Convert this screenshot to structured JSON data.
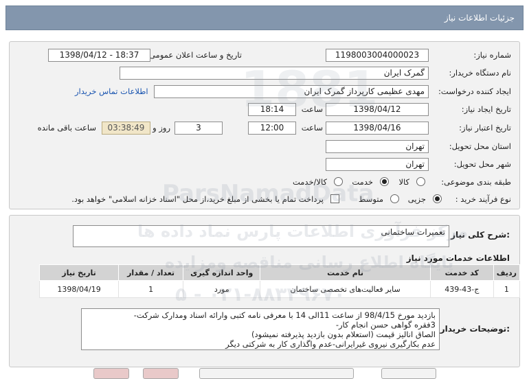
{
  "header": {
    "title": "جزئیات اطلاعات نیاز"
  },
  "form": {
    "need_number_label": "شماره نیاز:",
    "need_number": "1198003004000023",
    "announce_label": "تاریخ و ساعت اعلان عمومی:",
    "announce_value": "1398/04/12 - 18:37",
    "buyer_label": "نام دستگاه خریدار:",
    "buyer_value": "گمرک ایران",
    "creator_label": "ایجاد کننده درخواست:",
    "creator_value": "مهدی عظیمی کارپرداز گمرک ایران",
    "contact_link": "اطلاعات تماس خریدار",
    "created_label": "تاریخ ایجاد نیاز:",
    "created_date": "1398/04/12",
    "time_label": "ساعت",
    "created_time": "18:14",
    "validity_label": "تاریخ اعتبار نیاز:",
    "validity_date": "1398/04/16",
    "validity_time": "12:00",
    "days_value": "3",
    "days_label": "روز و",
    "remaining_time": "03:38:49",
    "remaining_label": "ساعت باقی مانده",
    "province_label": "استان محل تحویل:",
    "province_value": "تهران",
    "city_label": "شهر محل تحویل:",
    "city_value": "تهران",
    "category_label": "طبقه بندی موضوعی:",
    "category_options": [
      "کالا",
      "خدمت",
      "کالا/خدمت"
    ],
    "category_selected": "خدمت",
    "process_label": "نوع فرآیند خرید :",
    "process_options": [
      "جزیی",
      "متوسط"
    ],
    "process_selected": "جزیی",
    "payment_note": "پرداخت تمام یا بخشی از مبلغ خرید،از محل \"اسناد خزانه اسلامی\" خواهد بود."
  },
  "summary": {
    "label": "شرح کلی نیاز:",
    "value": "تعمیرات ساختمانی"
  },
  "services": {
    "heading": "اطلاعات خدمات مورد نیاز",
    "columns": [
      "ردیف",
      "کد خدمت",
      "نام خدمت",
      "واحد اندازه گیری",
      "تعداد / مقدار",
      "تاریخ نیاز"
    ],
    "rows": [
      [
        "1",
        "ج-43-439",
        "سایر فعالیت‌های تخصصی ساختمان",
        "مورد",
        "1",
        "1398/04/19"
      ]
    ]
  },
  "buyer_notes": {
    "label": "توضیحات خریدار:",
    "lines": [
      "بازدید مورخ 98/4/15 از ساعت 11الی 14 با معرفی نامه کتبی وارائه اسناد ومدارک شرکت-",
      "3فقره گواهی حسن انجام کار-",
      "الصاق انالیز قیمت (استعلام بدون بازدید پذیرفته نمیشود)",
      "عدم بکارگیری نیروی غیرایرانی-عدم واگذاری کار به شرکتی دیگر"
    ]
  },
  "watermark": {
    "text1": "ParsNamadData",
    "text2": "مرکز فرآوری اطلاعات پارس نماد داده ها",
    "text3": "پایگاه اطلاع رسانی مناقصه ومزایده",
    "text4": "۰۲۱-۸۸۳۴۹۶۷۰ - ۵",
    "text5": "1881"
  },
  "colors": {
    "title_bar": "#8396ad",
    "panel": "#f2f2f2",
    "table_header": "#d3d3d3",
    "timer": "#f1e6c8",
    "link": "#1a55b0"
  }
}
